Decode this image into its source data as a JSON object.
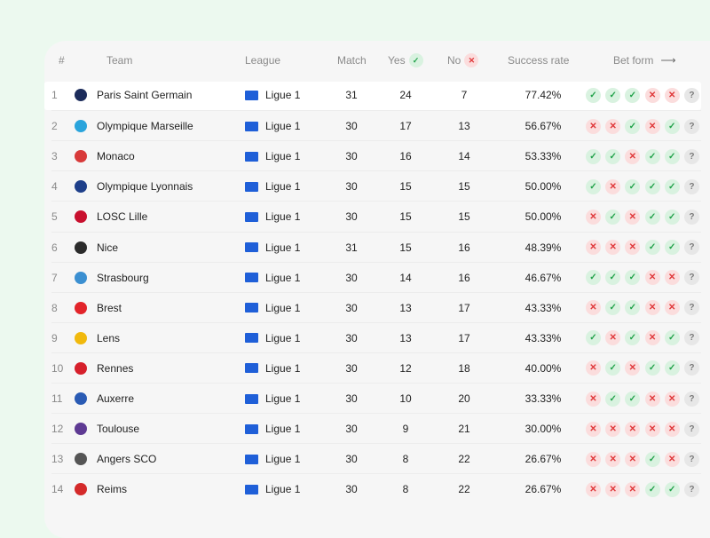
{
  "header": {
    "rank": "#",
    "team": "Team",
    "league": "League",
    "match": "Match",
    "yes": "Yes",
    "no": "No",
    "success_rate": "Success rate",
    "bet_form": "Bet form",
    "bet_form_arrow": "⟶"
  },
  "icons": {
    "check": "✓",
    "cross": "✕",
    "unknown": "?"
  },
  "colors": {
    "page_bg": "#ecf9ef",
    "card_bg": "#f6f6f6",
    "check_bg": "#d9f2e0",
    "check_fg": "#22a24a",
    "cross_bg": "#fbdddd",
    "cross_fg": "#e0383a",
    "league_flag": "#1f5fd8"
  },
  "rows": [
    {
      "num": "1",
      "team": "Paris Saint Germain",
      "league": "Ligue 1",
      "match": "31",
      "yes": "24",
      "no": "7",
      "rate": "77.42%",
      "logo_color": "#1c2c5b",
      "form": [
        "check",
        "check",
        "check",
        "cross",
        "cross",
        "unknown"
      ]
    },
    {
      "num": "2",
      "team": "Olympique Marseille",
      "league": "Ligue 1",
      "match": "30",
      "yes": "17",
      "no": "13",
      "rate": "56.67%",
      "logo_color": "#2aa4dc",
      "form": [
        "cross",
        "cross",
        "check",
        "cross",
        "check",
        "unknown"
      ]
    },
    {
      "num": "3",
      "team": "Monaco",
      "league": "Ligue 1",
      "match": "30",
      "yes": "16",
      "no": "14",
      "rate": "53.33%",
      "logo_color": "#d83a3a",
      "form": [
        "check",
        "check",
        "cross",
        "check",
        "check",
        "unknown"
      ]
    },
    {
      "num": "4",
      "team": "Olympique Lyonnais",
      "league": "Ligue 1",
      "match": "30",
      "yes": "15",
      "no": "15",
      "rate": "50.00%",
      "logo_color": "#1e3f8a",
      "form": [
        "check",
        "cross",
        "check",
        "check",
        "check",
        "unknown"
      ]
    },
    {
      "num": "5",
      "team": "LOSC Lille",
      "league": "Ligue 1",
      "match": "30",
      "yes": "15",
      "no": "15",
      "rate": "50.00%",
      "logo_color": "#c8102e",
      "form": [
        "cross",
        "check",
        "cross",
        "check",
        "check",
        "unknown"
      ]
    },
    {
      "num": "6",
      "team": "Nice",
      "league": "Ligue 1",
      "match": "31",
      "yes": "15",
      "no": "16",
      "rate": "48.39%",
      "logo_color": "#2b2b2b",
      "form": [
        "cross",
        "cross",
        "cross",
        "check",
        "check",
        "unknown"
      ]
    },
    {
      "num": "7",
      "team": "Strasbourg",
      "league": "Ligue 1",
      "match": "30",
      "yes": "14",
      "no": "16",
      "rate": "46.67%",
      "logo_color": "#3b8fd1",
      "form": [
        "check",
        "check",
        "check",
        "cross",
        "cross",
        "unknown"
      ]
    },
    {
      "num": "8",
      "team": "Brest",
      "league": "Ligue 1",
      "match": "30",
      "yes": "13",
      "no": "17",
      "rate": "43.33%",
      "logo_color": "#e2242a",
      "form": [
        "cross",
        "check",
        "check",
        "cross",
        "cross",
        "unknown"
      ]
    },
    {
      "num": "9",
      "team": "Lens",
      "league": "Ligue 1",
      "match": "30",
      "yes": "13",
      "no": "17",
      "rate": "43.33%",
      "logo_color": "#f1b90d",
      "form": [
        "check",
        "cross",
        "check",
        "cross",
        "check",
        "unknown"
      ]
    },
    {
      "num": "10",
      "team": "Rennes",
      "league": "Ligue 1",
      "match": "30",
      "yes": "12",
      "no": "18",
      "rate": "40.00%",
      "logo_color": "#d6202b",
      "form": [
        "cross",
        "check",
        "cross",
        "check",
        "check",
        "unknown"
      ]
    },
    {
      "num": "11",
      "team": "Auxerre",
      "league": "Ligue 1",
      "match": "30",
      "yes": "10",
      "no": "20",
      "rate": "33.33%",
      "logo_color": "#2a5bb4",
      "form": [
        "cross",
        "check",
        "check",
        "cross",
        "cross",
        "unknown"
      ]
    },
    {
      "num": "12",
      "team": "Toulouse",
      "league": "Ligue 1",
      "match": "30",
      "yes": "9",
      "no": "21",
      "rate": "30.00%",
      "logo_color": "#5e3a93",
      "form": [
        "cross",
        "cross",
        "cross",
        "cross",
        "cross",
        "unknown"
      ]
    },
    {
      "num": "13",
      "team": "Angers SCO",
      "league": "Ligue 1",
      "match": "30",
      "yes": "8",
      "no": "22",
      "rate": "26.67%",
      "logo_color": "#555555",
      "form": [
        "cross",
        "cross",
        "cross",
        "check",
        "cross",
        "unknown"
      ]
    },
    {
      "num": "14",
      "team": "Reims",
      "league": "Ligue 1",
      "match": "30",
      "yes": "8",
      "no": "22",
      "rate": "26.67%",
      "logo_color": "#d42a2a",
      "form": [
        "cross",
        "cross",
        "cross",
        "check",
        "check",
        "unknown"
      ]
    }
  ]
}
